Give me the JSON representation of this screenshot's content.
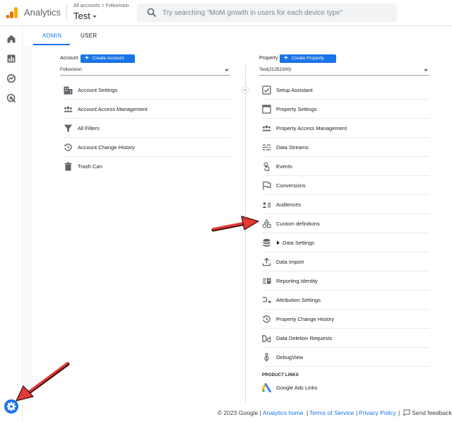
{
  "header": {
    "app_name": "Analytics",
    "breadcrumb_account": "All accounts",
    "breadcrumb_sep": ">",
    "breadcrumb_property": "Foliovision",
    "property_title": "Test",
    "search_placeholder": "Try searching \"MoM growth in users for each device type\""
  },
  "tabs": [
    {
      "label": "ADMIN",
      "active": true
    },
    {
      "label": "USER",
      "active": false
    }
  ],
  "account": {
    "heading": "Account",
    "create_label": "Create Account",
    "selected": "Foliovision",
    "items": [
      {
        "label": "Account Settings",
        "icon": "building-icon"
      },
      {
        "label": "Account Access Management",
        "icon": "people-icon"
      },
      {
        "label": "All Filters",
        "icon": "filter-icon"
      },
      {
        "label": "Account Change History",
        "icon": "history-icon"
      },
      {
        "label": "Trash Can",
        "icon": "trash-icon"
      }
    ]
  },
  "property": {
    "heading": "Property",
    "create_label": "Create Property",
    "selected": "Test(21252300)",
    "items": [
      {
        "label": "Setup Assistant",
        "icon": "checkbox-icon"
      },
      {
        "label": "Property Settings",
        "icon": "window-icon"
      },
      {
        "label": "Property Access Management",
        "icon": "people-icon"
      },
      {
        "label": "Data Streams",
        "icon": "streams-icon"
      },
      {
        "label": "Events",
        "icon": "touch-icon"
      },
      {
        "label": "Conversions",
        "icon": "flag-icon"
      },
      {
        "label": "Audiences",
        "icon": "audience-icon"
      },
      {
        "label": "Custom definitions",
        "icon": "shapes-icon"
      },
      {
        "label": "Data Settings",
        "icon": "database-icon"
      },
      {
        "label": "Data Import",
        "icon": "upload-icon"
      },
      {
        "label": "Reporting Identity",
        "icon": "identity-icon"
      },
      {
        "label": "Attribution Settings",
        "icon": "attribution-icon"
      },
      {
        "label": "Property Change History",
        "icon": "history-icon"
      },
      {
        "label": "Data Deletion Requests",
        "icon": "dd-icon"
      },
      {
        "label": "DebugView",
        "icon": "debug-icon"
      }
    ],
    "links_heading": "PRODUCT LINKS",
    "links": [
      {
        "label": "Google Ads Links",
        "icon": "google-ads-icon"
      }
    ]
  },
  "footer": {
    "copyright": "© 2023 Google |",
    "home": "Analytics home",
    "sep1": "|",
    "terms": "Terms of Service",
    "sep2": "|",
    "privacy": "Privacy Policy",
    "sep3": "|",
    "feedback": "Send feedback"
  },
  "colors": {
    "accent": "#1a73e8",
    "annotation_arrow": "#e53935",
    "logo_orange": "#f9ab00",
    "logo_dark_orange": "#e37400"
  }
}
